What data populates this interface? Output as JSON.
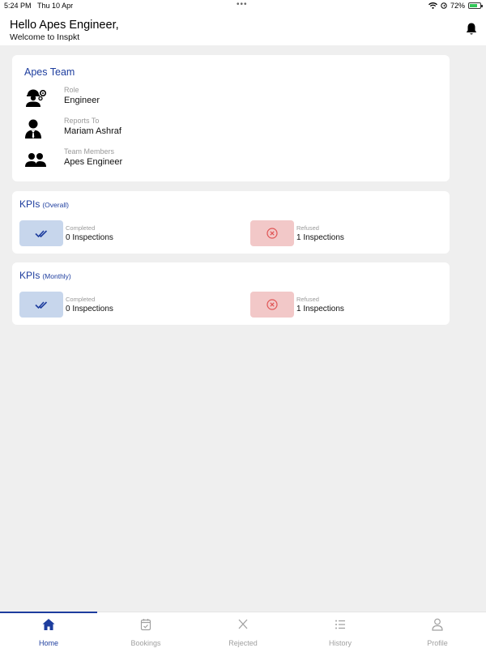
{
  "status_bar": {
    "time": "5:24 PM",
    "date": "Thu 10 Apr",
    "battery": "72%",
    "battery_level": 0.72
  },
  "header": {
    "greeting": "Hello Apes Engineer,",
    "subtitle": "Welcome to Inspkt"
  },
  "team": {
    "title": "Apes Team",
    "rows": [
      {
        "label": "Role",
        "value": "Engineer",
        "icon": "engineer-icon"
      },
      {
        "label": "Reports To",
        "value": "Mariam Ashraf",
        "icon": "manager-icon"
      },
      {
        "label": "Team Members",
        "value": "Apes Engineer",
        "icon": "group-icon"
      }
    ]
  },
  "kpis": [
    {
      "title": "KPIs",
      "period": "(Overall)",
      "completed_label": "Completed",
      "completed_value": "0 Inspections",
      "refused_label": "Refused",
      "refused_value": "1 Inspections"
    },
    {
      "title": "KPIs",
      "period": "(Monthly)",
      "completed_label": "Completed",
      "completed_value": "0 Inspections",
      "refused_label": "Refused",
      "refused_value": "1 Inspections"
    }
  ],
  "tabs": [
    {
      "label": "Home",
      "icon": "home-icon",
      "active": true
    },
    {
      "label": "Bookings",
      "icon": "calendar-check-icon",
      "active": false
    },
    {
      "label": "Rejected",
      "icon": "x-icon",
      "active": false
    },
    {
      "label": "History",
      "icon": "list-icon",
      "active": false
    },
    {
      "label": "Profile",
      "icon": "user-icon",
      "active": false
    }
  ],
  "colors": {
    "accent": "#1d3d9e",
    "completed_bg": "#c7d6ec",
    "refused_bg": "#f2c8c8",
    "refused_icon": "#e05454",
    "background": "#efefef"
  }
}
